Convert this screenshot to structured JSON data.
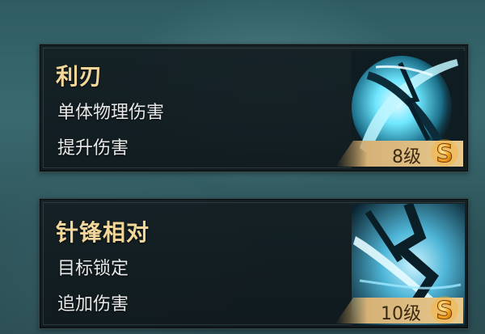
{
  "skills": [
    {
      "title": "利刃",
      "line1": "单体物理伤害",
      "line2": "提升伤害",
      "level": "8级",
      "icon": "blade-slash-icon",
      "accent": "#6fe7ff"
    },
    {
      "title": "针锋相对",
      "line1": "目标锁定",
      "line2": "追加伤害",
      "level": "10级",
      "icon": "crossing-blades-icon",
      "accent": "#7fd8ff"
    }
  ],
  "colors": {
    "title": "#f3d79a",
    "tag": "#d9b77a",
    "coin": "#f5a623"
  },
  "currency_icon": "gold-coin-icon"
}
